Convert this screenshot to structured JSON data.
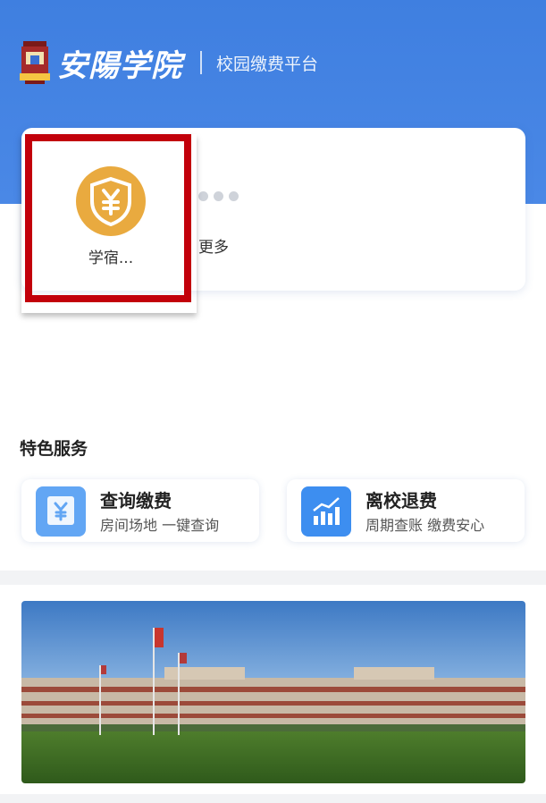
{
  "header": {
    "logo_text": "安陽学院",
    "platform_title": "校园缴费平台"
  },
  "quick_actions": [
    {
      "label": "学宿...",
      "icon": "shield-yuan-icon"
    },
    {
      "label": "更多",
      "icon": "more-dots-icon"
    }
  ],
  "section": {
    "title": "特色服务"
  },
  "services": [
    {
      "title": "查询缴费",
      "subtitle": "房间场地 一键查询",
      "icon": "receipt-yuan-icon"
    },
    {
      "title": "离校退费",
      "subtitle": "周期查账 缴费安心",
      "icon": "bar-chart-trend-icon"
    }
  ],
  "banner": {
    "image": "campus-building-photo"
  },
  "colors": {
    "header_blue": "#3f7fe0",
    "shield_gold": "#e9aa3f",
    "highlight_red": "#c2000b",
    "service_icon_blue": "#3d8ef0"
  }
}
